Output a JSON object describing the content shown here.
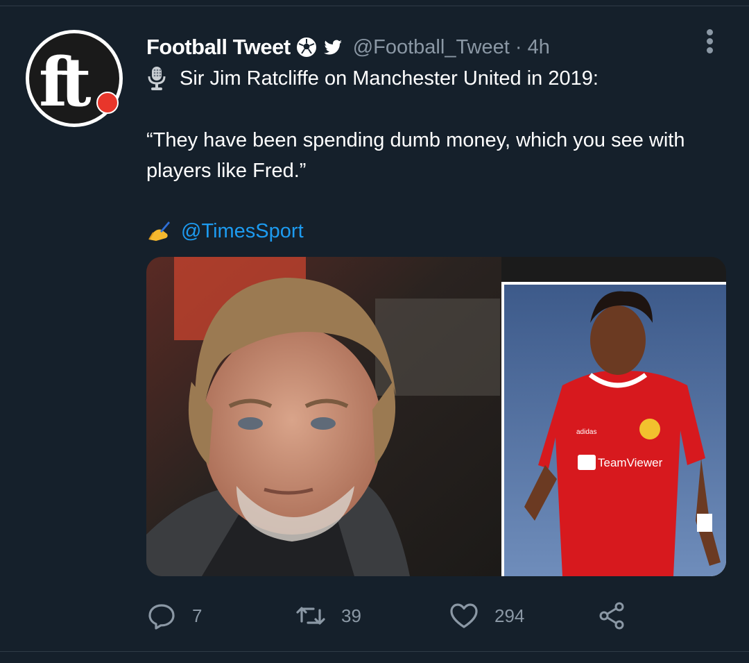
{
  "tweet": {
    "author_name": "Football Tweet",
    "handle": "@Football_Tweet",
    "separator": "·",
    "time": "4h",
    "line1": "Sir Jim Ratcliffe on Manchester United in 2019:",
    "quote": "“They have been spending dumb money, which you see with players like Fred.”",
    "credit_handle": "@TimesSport",
    "avatar_text": "ft",
    "badges": [
      "soccer-ball-emoji",
      "twitter-bird-icon"
    ],
    "line1_icon": "microphone-emoji",
    "credit_icon": "writing-hand-emoji"
  },
  "media": {
    "jersey_sponsor": "TeamViewer",
    "kit_brand": "adidas"
  },
  "actions": {
    "replies": "7",
    "retweets": "39",
    "likes": "294"
  },
  "colors": {
    "background": "#15202b",
    "text": "#ffffff",
    "secondary_text": "#8b98a5",
    "link": "#1d9bf0",
    "jersey_red": "#d7191e"
  }
}
